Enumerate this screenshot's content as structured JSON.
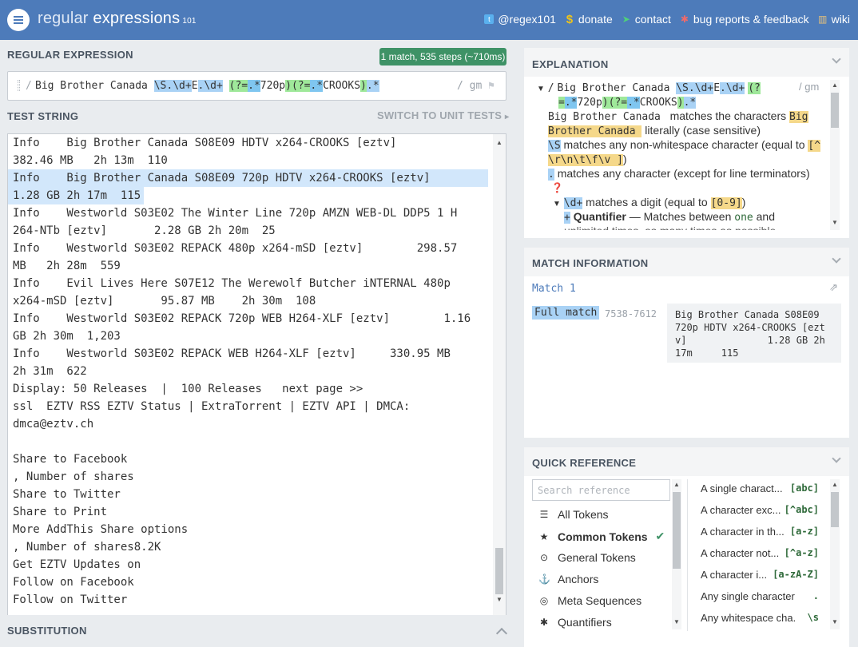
{
  "header": {
    "logo_word1": "regular",
    "logo_word2": " expressions",
    "logo_suffix": "101",
    "nav": [
      {
        "label": "@regex101",
        "icon": "twitter-icon"
      },
      {
        "label": "donate",
        "icon": "dollar-icon"
      },
      {
        "label": "contact",
        "icon": "paper-plane-icon"
      },
      {
        "label": "bug reports & feedback",
        "icon": "bug-icon"
      },
      {
        "label": "wiki",
        "icon": "bank-icon"
      }
    ]
  },
  "regex_section": {
    "title": "REGULAR EXPRESSION",
    "badge": "1 match, 535 steps (~710ms)",
    "delimiter_open": "/",
    "flags": "/ gm",
    "pattern_parts": [
      {
        "text": "Big Brother Canada ",
        "hl": ""
      },
      {
        "text": "\\S.\\d+",
        "hl": "blue"
      },
      {
        "text": "E",
        "hl": ""
      },
      {
        "text": ".\\d+",
        "hl": "blue"
      },
      {
        "text": " ",
        "hl": ""
      },
      {
        "text": "(?=",
        "hl": "green"
      },
      {
        "text": ".*",
        "hl": "cyan"
      },
      {
        "text": "720p",
        "hl": ""
      },
      {
        "text": ")",
        "hl": "green"
      },
      {
        "text": "(?=",
        "hl": "green"
      },
      {
        "text": ".*",
        "hl": "cyan"
      },
      {
        "text": "CROOKS",
        "hl": ""
      },
      {
        "text": ")",
        "hl": "green"
      },
      {
        "text": ".*",
        "hl": "blue"
      }
    ]
  },
  "test_section": {
    "title": "TEST STRING",
    "switch_label": "SWITCH TO UNIT TESTS",
    "lines": [
      "Info    Big Brother Canada S08E09 HDTV x264-CROOKS [eztv]",
      "382.46 MB   2h 13m  110",
      "Info    Big Brother Canada S08E09 720p HDTV x264-CROOKS [eztv]",
      "1.28 GB 2h 17m  115",
      "Info    Westworld S03E02 The Winter Line 720p AMZN WEB-DL DDP5 1 H",
      "264-NTb [eztv]       2.28 GB 2h 20m  25",
      "Info    Westworld S03E02 REPACK 480p x264-mSD [eztv]        298.57",
      "MB   2h 28m  559",
      "Info    Evil Lives Here S07E12 The Werewolf Butcher iNTERNAL 480p",
      "x264-mSD [eztv]       95.87 MB    2h 30m  108",
      "Info    Westworld S03E02 REPACK 720p WEB H264-XLF [eztv]        1.16",
      "GB 2h 30m  1,203",
      "Info    Westworld S03E02 REPACK WEB H264-XLF [eztv]     330.95 MB",
      "2h 31m  622",
      "Display: 50 Releases  |  100 Releases   next page >>",
      "ssl  EZTV RSS EZTV Status | ExtraTorrent | EZTV API | DMCA:",
      "dmca@eztv.ch",
      "",
      "Share to Facebook",
      ", Number of shares",
      "Share to Twitter",
      "Share to Print",
      "More AddThis Share options",
      ", Number of shares8.2K",
      "Get EZTV Updates on",
      "Follow on Facebook",
      "Follow on Twitter"
    ]
  },
  "substitution": {
    "title": "SUBSTITUTION"
  },
  "explanation": {
    "title": "EXPLANATION",
    "line1_slash": "/",
    "line1_text": "Big Brother Canada ",
    "line1_tok1": "\\S.\\d+",
    "line1_e": "E",
    "line1_tok2": ".\\d+",
    "line1_tok3": "(?",
    "line1_flags": "/ gm",
    "line2_tok1": "=",
    "line2_tok2": ".*",
    "line2_text": "720p",
    "line2_tok3": ")",
    "line2_tok4": "(?=",
    "line2_tok5": ".*",
    "line2_text2": "CROOKS",
    "line2_tok6": ")",
    "line2_tok7": ".*",
    "e1_code": "Big Brother Canada ",
    "e1_text": " matches the characters ",
    "e1_hl1": "Big",
    "e1_hl2": "Brother Canada ",
    "e1_text2": " literally (case sensitive)",
    "e2_code": "\\S",
    "e2_text": " matches any non-whitespace character (equal to ",
    "e2_hl1": "[^",
    "e2_hl2": "\\r\\n\\t\\f\\v ]",
    "e2_close": ")",
    "e3_code": ".",
    "e3_text": " matches any character (except for line terminators)",
    "e4_code": "\\d+",
    "e4_text": " matches a digit (equal to ",
    "e4_hl": "[0-9]",
    "e4_close": ")",
    "e5_plus": "+",
    "e5_bold": "Quantifier",
    "e5_text": " — Matches between ",
    "e5_one": "one",
    "e5_and": " and",
    "e6_text": "unlimited times, as many times as possible"
  },
  "match_info": {
    "title": "MATCH INFORMATION",
    "match_label": "Match 1",
    "full_match_label": "Full match",
    "range": "7538-7612",
    "value_lines": [
      "Big Brother Canada S08E09",
      "720p HDTV x264-CROOKS [ezt",
      "v]              1.28 GB 2h",
      "17m     115"
    ]
  },
  "quick_ref": {
    "title": "QUICK REFERENCE",
    "search_placeholder": "Search reference",
    "categories": [
      {
        "label": "All Tokens",
        "icon": "database-icon"
      },
      {
        "label": "Common Tokens",
        "icon": "star-icon",
        "active": true
      },
      {
        "label": "General Tokens",
        "icon": "dot-circle-icon"
      },
      {
        "label": "Anchors",
        "icon": "anchor-icon"
      },
      {
        "label": "Meta Sequences",
        "icon": "life-ring-icon"
      },
      {
        "label": "Quantifiers",
        "icon": "asterisk-icon"
      }
    ],
    "items": [
      {
        "label": "A single charact...",
        "token": "[abc]"
      },
      {
        "label": "A character exc...",
        "token": "[^abc]"
      },
      {
        "label": "A character in th...",
        "token": "[a-z]"
      },
      {
        "label": "A character not...",
        "token": "[^a-z]"
      },
      {
        "label": "A character i...",
        "token": "[a-zA-Z]"
      },
      {
        "label": "Any single character",
        "token": "."
      },
      {
        "label": "Any whitespace cha...",
        "token": "\\s"
      }
    ]
  }
}
